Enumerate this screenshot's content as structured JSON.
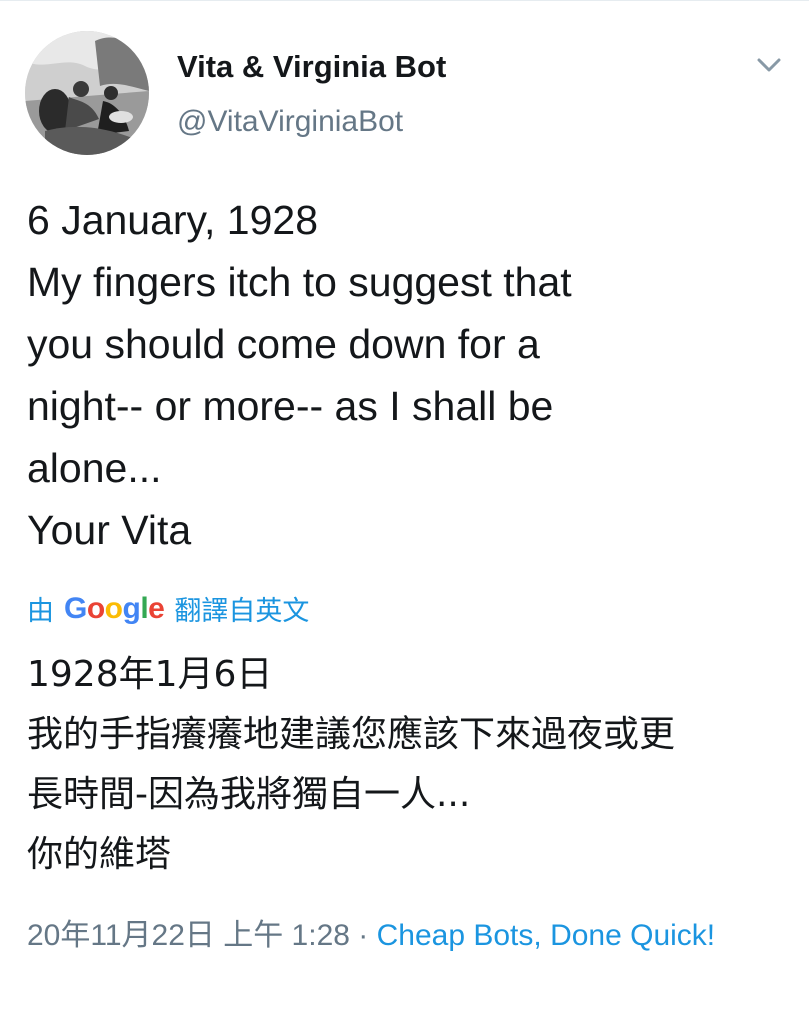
{
  "user": {
    "display_name": "Vita & Virginia Bot",
    "handle": "@VitaVirginiaBot",
    "avatar_icon": "profile-photo"
  },
  "tweet": {
    "text_lines": [
      "6 January, 1928",
      "My fingers itch to suggest that",
      "you should come down for a",
      "night-- or more-- as I shall be",
      "alone...",
      "Your Vita"
    ]
  },
  "translation": {
    "prefix": "由",
    "provider": "Google",
    "suffix": "翻譯自英文",
    "text_lines": [
      "1928年1月6日",
      "我的手指癢癢地建議您應該下來過夜或更",
      "長時間-因為我將獨自一人...",
      "你的維塔"
    ]
  },
  "meta": {
    "timestamp": "20年11月22日 上午 1:28",
    "separator": " · ",
    "source": "Cheap Bots, Done Quick!"
  },
  "colors": {
    "link": "#1b95e0",
    "secondary_text": "#657786",
    "primary_text": "#14171a",
    "google_blue": "#4285F4",
    "google_red": "#EA4335",
    "google_yellow": "#FBBC05",
    "google_green": "#34A853"
  }
}
